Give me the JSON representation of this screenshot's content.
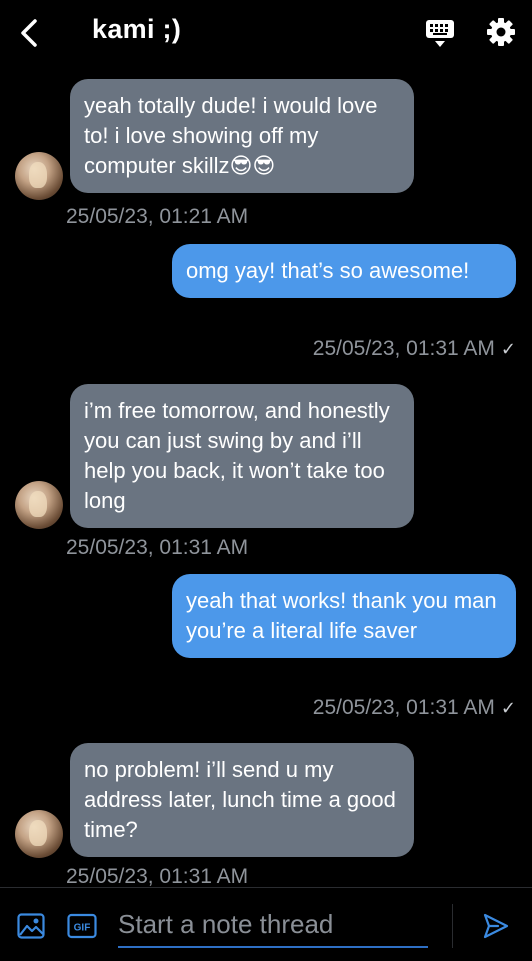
{
  "header": {
    "title": "kami ;)",
    "back_icon": "chevron-left-icon",
    "keyboard_icon": "keyboard-icon",
    "settings_icon": "gear-icon"
  },
  "messages": [
    {
      "direction": "incoming",
      "text": "yeah totally dude! i would love to! i love showing off my computer skillz😎😎",
      "timestamp": "25/05/23, 01:21 AM"
    },
    {
      "direction": "outgoing",
      "text": "omg yay! that’s so awesome!",
      "timestamp": "25/05/23, 01:31 AM",
      "status": "✓"
    },
    {
      "direction": "incoming",
      "text": "i’m free tomorrow, and honestly you can just swing by and i’ll help you back, it won’t take too long",
      "timestamp": "25/05/23, 01:31 AM"
    },
    {
      "direction": "outgoing",
      "text": "yeah that works! thank you man you’re a literal life saver",
      "timestamp": "25/05/23, 01:31 AM",
      "status": "✓"
    },
    {
      "direction": "incoming",
      "text": "no problem! i’ll send u my address later, lunch time a good time?",
      "timestamp": "25/05/23, 01:31 AM"
    }
  ],
  "composer": {
    "placeholder": "Start a note thread",
    "value": "",
    "image_icon": "image-icon",
    "gif_label": "GIF",
    "send_icon": "send-icon"
  },
  "colors": {
    "background": "#000000",
    "incoming_bubble": "#6a7481",
    "outgoing_bubble": "#4c98ea",
    "timestamp": "#8f949b",
    "accent": "#3b8ae0"
  }
}
